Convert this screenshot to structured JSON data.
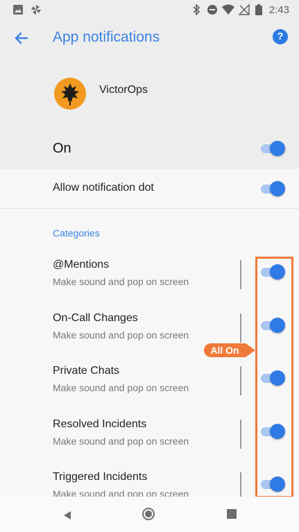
{
  "status_bar": {
    "time": "2:43",
    "left_icons": [
      "image-icon",
      "pinwheel-icon"
    ],
    "right_icons": [
      "bluetooth-icon",
      "do-not-disturb-icon",
      "wifi-icon",
      "no-signal-icon",
      "battery-icon"
    ]
  },
  "app_bar": {
    "title": "App notifications",
    "back_icon": "back-arrow-icon",
    "help_icon": "help-icon"
  },
  "app": {
    "name": "VictorOps",
    "icon": "victorops-leaf-logo"
  },
  "master": {
    "label": "On",
    "enabled": true
  },
  "notification_dot": {
    "label": "Allow notification dot",
    "enabled": true
  },
  "categories": {
    "header": "Categories",
    "items": [
      {
        "title": "@Mentions",
        "subtitle": "Make sound and pop on screen",
        "enabled": true
      },
      {
        "title": "On-Call Changes",
        "subtitle": "Make sound and pop on screen",
        "enabled": true
      },
      {
        "title": "Private Chats",
        "subtitle": "Make sound and pop on screen",
        "enabled": true
      },
      {
        "title": "Resolved Incidents",
        "subtitle": "Make sound and pop on screen",
        "enabled": true
      },
      {
        "title": "Triggered Incidents",
        "subtitle": "Make sound and pop on screen",
        "enabled": true
      }
    ]
  },
  "annotation": {
    "label": "All On",
    "color": "#f07a3a"
  },
  "colors": {
    "accent": "#2f7ae5",
    "title": "#3b82e3"
  },
  "nav_bar": {
    "icons": [
      "back-icon",
      "home-icon",
      "recents-icon"
    ]
  }
}
